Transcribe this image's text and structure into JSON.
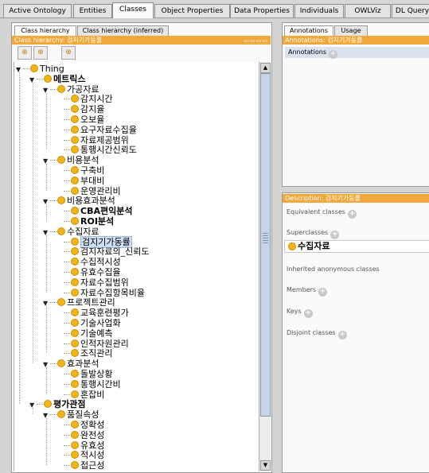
{
  "main_tabs": [
    "Active Ontology",
    "Entities",
    "Classes",
    "Object Properties",
    "Data Properties",
    "Individuals",
    "OWLViz",
    "DL Query"
  ],
  "active_main_tab": "Classes",
  "left_panel": {
    "tabs": [
      "Class hierarchy",
      "Class hierarchy (inferred)"
    ],
    "title": "Class hierarchy: 검지기가동률",
    "toolbar": [
      "add-subclass-icon",
      "add-sibling-icon",
      "delete-class-icon"
    ]
  },
  "tree": [
    {
      "label": "Thing",
      "depth": 0,
      "expanded": true
    },
    {
      "label": "메트릭스",
      "depth": 1,
      "expanded": true,
      "bold": true
    },
    {
      "label": "가공자료",
      "depth": 2,
      "expanded": true
    },
    {
      "label": "감지시간",
      "depth": 3
    },
    {
      "label": "감지율",
      "depth": 3
    },
    {
      "label": "오보율",
      "depth": 3
    },
    {
      "label": "요구자료수집율",
      "depth": 3
    },
    {
      "label": "자료제공범위",
      "depth": 3
    },
    {
      "label": "통행시간신뢰도",
      "depth": 3
    },
    {
      "label": "비용분석",
      "depth": 2,
      "expanded": true
    },
    {
      "label": "구축비",
      "depth": 3
    },
    {
      "label": "부대비",
      "depth": 3
    },
    {
      "label": "운영관리비",
      "depth": 3
    },
    {
      "label": "비용효과분석",
      "depth": 2,
      "expanded": true
    },
    {
      "label": "CBA편익분석",
      "depth": 3,
      "bold": true
    },
    {
      "label": "ROI분석",
      "depth": 3,
      "bold": true
    },
    {
      "label": "수집자료",
      "depth": 2,
      "expanded": true
    },
    {
      "label": "검지기가동률",
      "depth": 3,
      "selected": true
    },
    {
      "label": "검지자료의_신뢰도",
      "depth": 3
    },
    {
      "label": "수집적시성",
      "depth": 3
    },
    {
      "label": "유효수집율",
      "depth": 3
    },
    {
      "label": "자료수집범위",
      "depth": 3
    },
    {
      "label": "자료수집항목비율",
      "depth": 3
    },
    {
      "label": "프로젝트관리",
      "depth": 2,
      "expanded": true
    },
    {
      "label": "교육훈련평가",
      "depth": 3
    },
    {
      "label": "기술사업화",
      "depth": 3
    },
    {
      "label": "기술예측",
      "depth": 3
    },
    {
      "label": "인적자원관리",
      "depth": 3
    },
    {
      "label": "조직관리",
      "depth": 3
    },
    {
      "label": "효과분석",
      "depth": 2,
      "expanded": true
    },
    {
      "label": "돌발상황",
      "depth": 3
    },
    {
      "label": "통행시간비",
      "depth": 3
    },
    {
      "label": "혼잡비",
      "depth": 3
    },
    {
      "label": "평가관점",
      "depth": 1,
      "expanded": true,
      "bold": true
    },
    {
      "label": "품질속성",
      "depth": 2,
      "expanded": true
    },
    {
      "label": "정확성",
      "depth": 3
    },
    {
      "label": "완전성",
      "depth": 3
    },
    {
      "label": "유효성",
      "depth": 3
    },
    {
      "label": "적시성",
      "depth": 3
    },
    {
      "label": "접근성",
      "depth": 3
    }
  ],
  "annotations_panel": {
    "tabs": [
      "Annotations",
      "Usage"
    ],
    "title": "Annotations: 검지기가동률",
    "header": "Annotations"
  },
  "description_panel": {
    "title": "Description: 검지기가동률",
    "sections": {
      "equivalent": "Equivalent classes",
      "superclasses": "Superclasses",
      "superclass_value": "수집자료",
      "inherited": "Inherited anonymous classes",
      "members": "Members",
      "keys": "Keys",
      "disjoint": "Disjoint classes"
    }
  },
  "colors": {
    "accent": "#f0a83a",
    "class_dot": "#f1b515",
    "selection": "#cfe0f2"
  }
}
